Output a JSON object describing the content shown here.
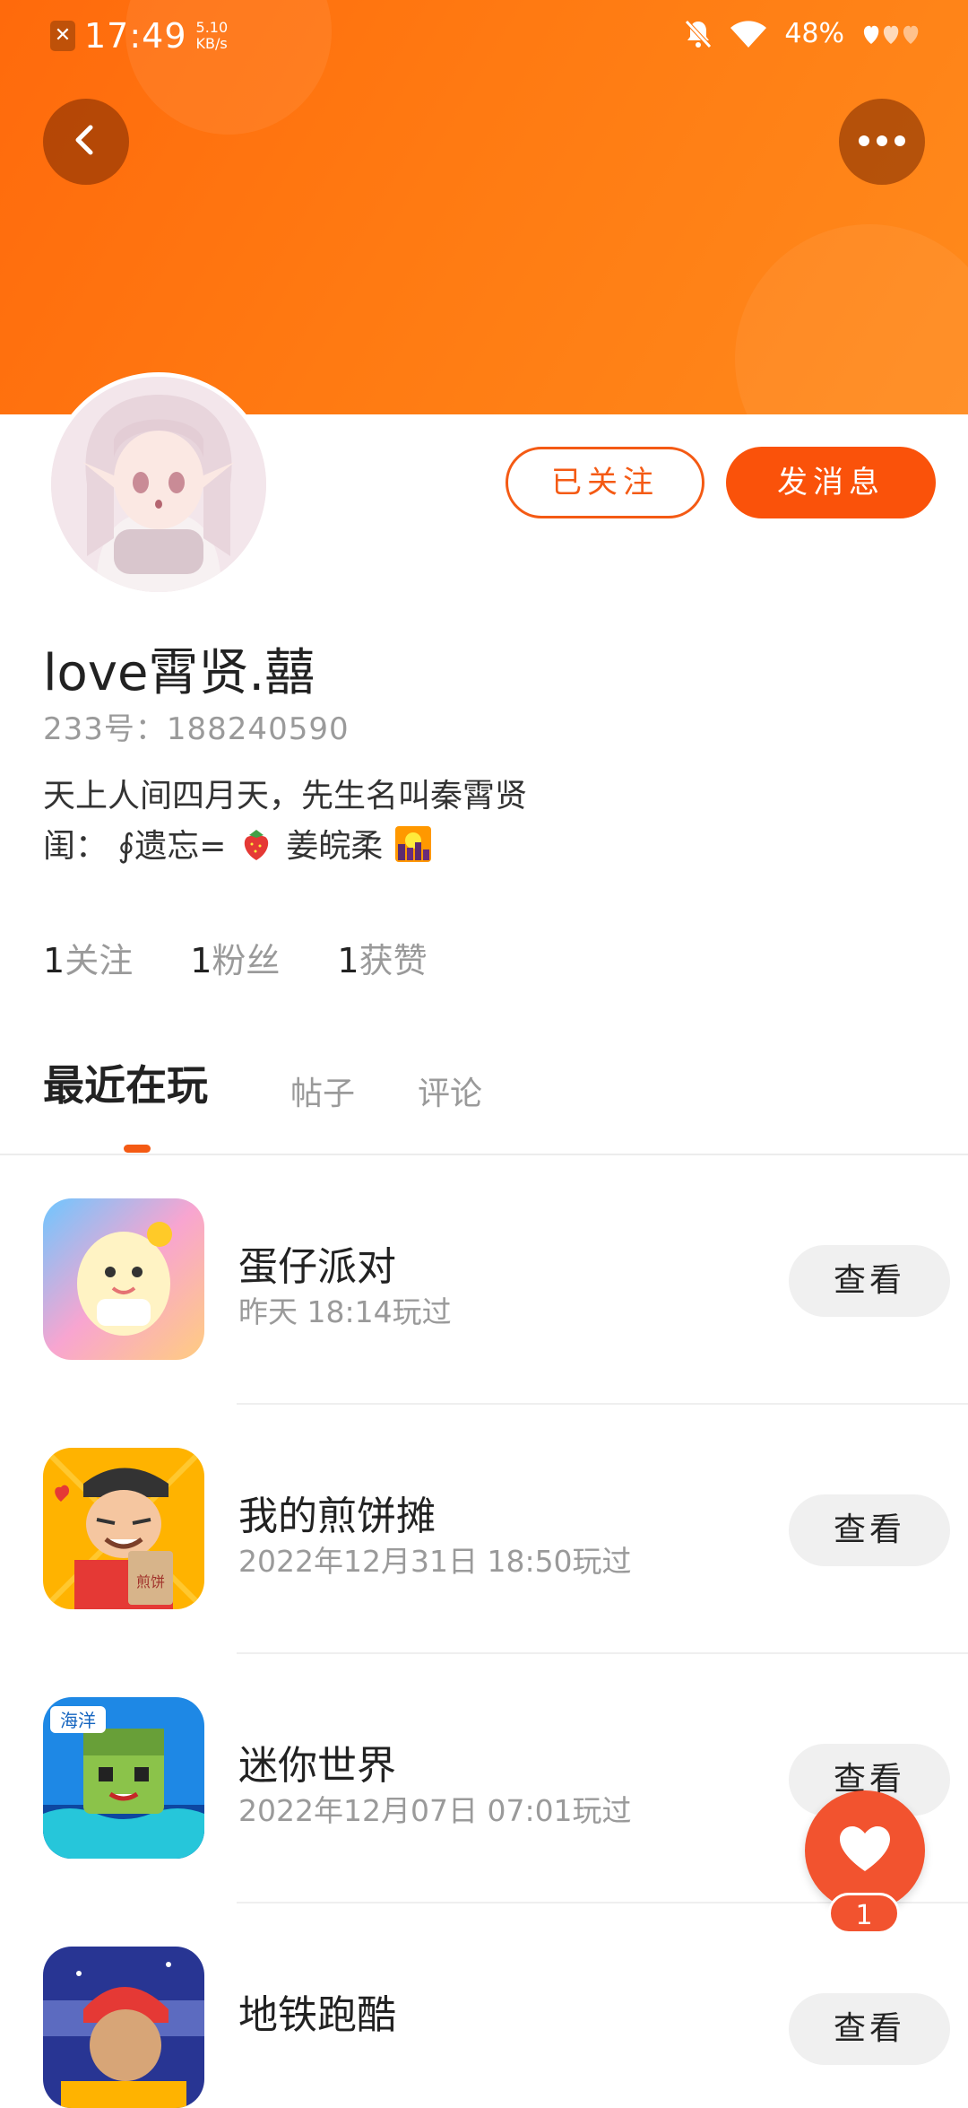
{
  "status_bar": {
    "time": "17:49",
    "speed_value": "5.10",
    "speed_unit": "KB/s",
    "battery": "48%"
  },
  "header": {
    "back_icon": "chevron-left-icon",
    "more_icon": "more-horizontal-icon",
    "accent_color": "#ff6a0c"
  },
  "profile": {
    "username": "love霄贤.囍",
    "uid_label": "233号：",
    "uid_value": "188240590",
    "bio_line1": "天上人间四月天，先生名叫秦霄贤",
    "bio_line2_prefix": "闺：",
    "bio_line2_part1": "∮遗忘=",
    "bio_line2_part2": "姜皖柔",
    "follow_button": "已关注",
    "message_button": "发消息"
  },
  "stats": [
    {
      "num": "1",
      "label": "关注"
    },
    {
      "num": "1",
      "label": "粉丝"
    },
    {
      "num": "1",
      "label": "获赞"
    }
  ],
  "tabs": [
    {
      "label": "最近在玩",
      "active": true
    },
    {
      "label": "帖子",
      "active": false
    },
    {
      "label": "评论",
      "active": false
    }
  ],
  "games": [
    {
      "name": "蛋仔派对",
      "time": "昨天 18:14玩过",
      "button": "查看"
    },
    {
      "name": "我的煎饼摊",
      "time": "2022年12月31日 18:50玩过",
      "button": "查看"
    },
    {
      "name": "迷你世界",
      "time": "2022年12月07日 07:01玩过",
      "button": "查看"
    },
    {
      "name": "地铁跑酷",
      "time": "",
      "button": "查看"
    }
  ],
  "favorite": {
    "icon": "heart-icon",
    "count": "1"
  }
}
